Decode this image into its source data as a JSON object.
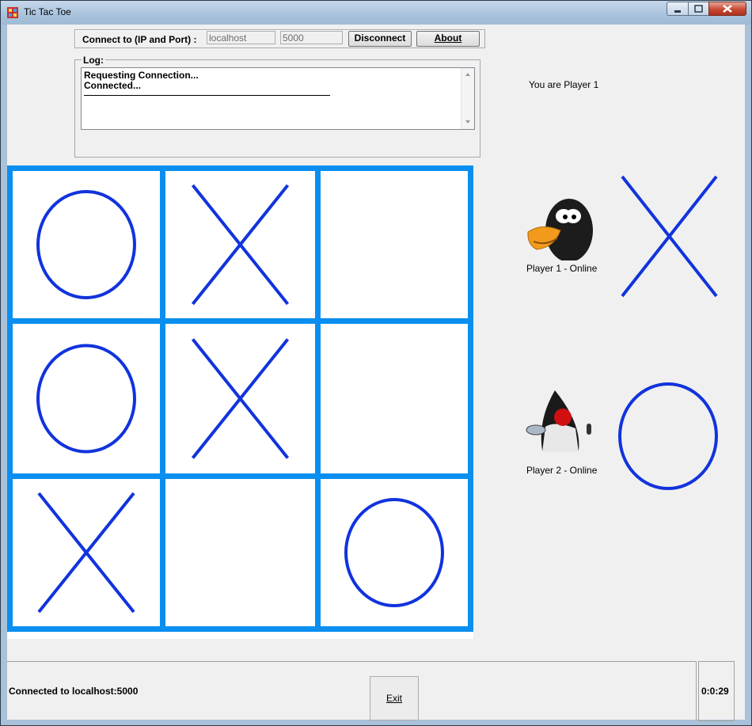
{
  "window": {
    "title": "Tic Tac Toe"
  },
  "connection": {
    "label": "Connect to (IP and Port) :",
    "host_value": "localhost",
    "port_value": "5000",
    "disconnect_label": "Disconnect",
    "about_label": "About"
  },
  "log": {
    "legend": "Log:",
    "lines": [
      "Requesting Connection...",
      "Connected..."
    ]
  },
  "player_info": "You are Player 1",
  "board": {
    "cells": [
      "O",
      "X",
      "",
      "O",
      "X",
      "",
      "X",
      "",
      "O"
    ],
    "grid_color": "#0a8ff0",
    "mark_color": "#1133dd"
  },
  "players": [
    {
      "label": "Player 1 - Online",
      "mark": "X",
      "avatar": "tux-penguin-icon"
    },
    {
      "label": "Player 2 - Online",
      "mark": "O",
      "avatar": "java-duke-icon"
    }
  ],
  "status": {
    "connection": "Connected to localhost:5000",
    "exit_label": "Exit",
    "timer": "0:0:29"
  }
}
